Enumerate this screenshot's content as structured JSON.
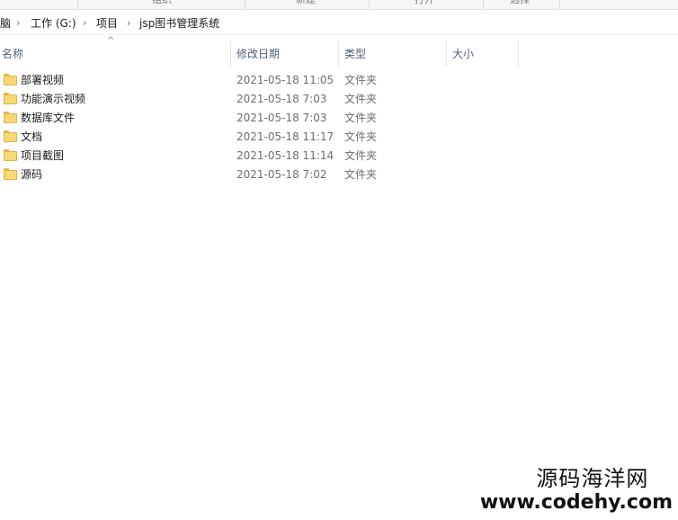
{
  "ribbon": {
    "groups": [
      "组织",
      "新建",
      "打开",
      "选择"
    ]
  },
  "address": {
    "crumbs": [
      "脑",
      "工作 (G:)",
      "项目",
      "jsp图书管理系统"
    ],
    "separator": "›"
  },
  "columns": {
    "name": "名称",
    "modified": "修改日期",
    "type": "类型",
    "size": "大小",
    "sort_indicator": "^"
  },
  "files": [
    {
      "name": "部署视频",
      "modified": "2021-05-18 11:05",
      "type": "文件夹",
      "size": ""
    },
    {
      "name": "功能演示视频",
      "modified": "2021-05-18 7:03",
      "type": "文件夹",
      "size": ""
    },
    {
      "name": "数据库文件",
      "modified": "2021-05-18 7:03",
      "type": "文件夹",
      "size": ""
    },
    {
      "name": "文档",
      "modified": "2021-05-18 11:17",
      "type": "文件夹",
      "size": ""
    },
    {
      "name": "项目截图",
      "modified": "2021-05-18 11:14",
      "type": "文件夹",
      "size": ""
    },
    {
      "name": "源码",
      "modified": "2021-05-18 7:02",
      "type": "文件夹",
      "size": ""
    }
  ],
  "watermark": {
    "title": "源码海洋网",
    "url": "www.codehy.com"
  },
  "colors": {
    "folder": "#f8d775",
    "header_text": "#4c607a"
  },
  "icons": {
    "folder": "folder-icon",
    "chevron": "chevron-right-icon",
    "sort": "sort-ascending-icon"
  }
}
